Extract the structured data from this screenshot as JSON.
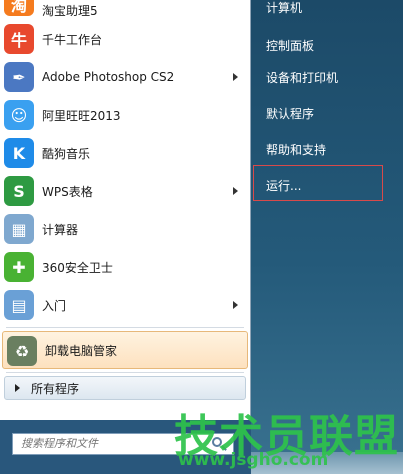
{
  "programs": [
    {
      "label": "淘宝助理5",
      "icon": "taobao-assistant-icon",
      "color": "#f57b1e",
      "arrow": false
    },
    {
      "label": "千牛工作台",
      "icon": "qianniu-icon",
      "color": "#e8492e",
      "arrow": false
    },
    {
      "label": "Adobe Photoshop CS2",
      "icon": "feather-icon",
      "color": "#4b78c2",
      "arrow": true
    },
    {
      "label": "阿里旺旺2013",
      "icon": "aliwangwang-icon",
      "color": "#3aa0f0",
      "arrow": false
    },
    {
      "label": "酷狗音乐",
      "icon": "kugou-icon",
      "color": "#1f8be8",
      "arrow": false
    },
    {
      "label": "WPS表格",
      "icon": "wps-spreadsheet-icon",
      "color": "#2e9a42",
      "arrow": true
    },
    {
      "label": "计算器",
      "icon": "calculator-icon",
      "color": "#7fa8cf",
      "arrow": false
    },
    {
      "label": "360安全卫士",
      "icon": "360-security-icon",
      "color": "#49b233",
      "arrow": false
    },
    {
      "label": "入门",
      "icon": "getting-started-icon",
      "color": "#6aa0d6",
      "arrow": true
    },
    {
      "label": "卸载电脑管家",
      "icon": "recycle-bin-icon",
      "color": "#6a7f60",
      "arrow": false
    }
  ],
  "icon_glyphs": [
    "淘",
    "牛",
    "✒",
    "☺",
    "K",
    "S",
    "▦",
    "✚",
    "▤",
    "♻"
  ],
  "all_programs": "所有程序",
  "search": {
    "placeholder": "搜索程序和文件"
  },
  "right_items": [
    "计算机",
    "控制面板",
    "设备和打印机",
    "默认程序",
    "帮助和支持",
    "运行..."
  ],
  "watermark": {
    "big": "技术员联盟",
    "url": "www.jsgho.com"
  },
  "taskbar_text": "帮助和支持"
}
